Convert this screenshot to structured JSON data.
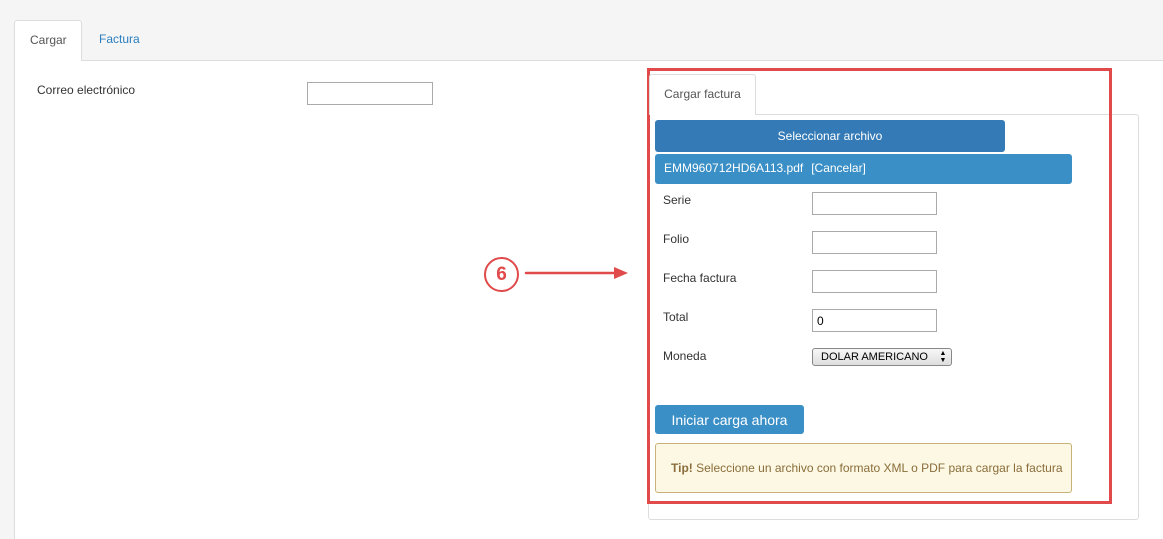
{
  "tabs": [
    {
      "label": "Cargar",
      "active": true
    },
    {
      "label": "Factura",
      "active": false
    }
  ],
  "email": {
    "label": "Correo electrónico",
    "value": ""
  },
  "upload_card": {
    "tab_label": "Cargar factura",
    "select_file_label": "Seleccionar archivo",
    "file_name": "EMM960712HD6A113.pdf",
    "cancel_label": "[Cancelar]",
    "fields": {
      "serie": {
        "label": "Serie",
        "value": ""
      },
      "folio": {
        "label": "Folio",
        "value": ""
      },
      "fecha": {
        "label": "Fecha factura",
        "value": ""
      },
      "total": {
        "label": "Total",
        "value": "0"
      },
      "moneda": {
        "label": "Moneda",
        "selected": "DOLAR AMERICANO"
      }
    },
    "start_upload_label": "Iniciar carga ahora",
    "tip": {
      "strong": "Tip!",
      "text": " Seleccione un archivo con formato XML o PDF para cargar la factura"
    }
  },
  "annotation": {
    "step_number": "6",
    "color": "#e04a4a"
  },
  "colors": {
    "primary_button": "#337ab7",
    "file_bar": "#3a8fc6",
    "tip_background": "#fcf8e3",
    "link": "#2a7ec0"
  }
}
